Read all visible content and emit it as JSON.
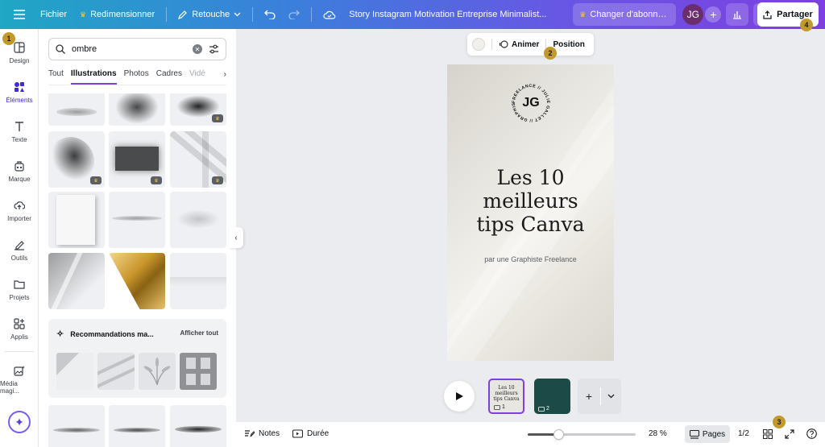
{
  "topbar": {
    "file_label": "Fichier",
    "resize_label": "Redimensionner",
    "edit_label": "Retouche",
    "doc_title": "Story Instagram Motivation Entreprise Minimalist...",
    "upgrade_label": "Changer d'abonne...",
    "avatar_initials": "JG",
    "share_label": "Partager"
  },
  "rail": {
    "items": [
      {
        "label": "Design"
      },
      {
        "label": "Éléments"
      },
      {
        "label": "Texte"
      },
      {
        "label": "Marque"
      },
      {
        "label": "Importer"
      },
      {
        "label": "Outils"
      },
      {
        "label": "Projets"
      },
      {
        "label": "Applis"
      },
      {
        "label": "Média magi..."
      }
    ]
  },
  "panel": {
    "search_value": "ombre",
    "tabs": [
      "Tout",
      "Illustrations",
      "Photos",
      "Cadres",
      "Vidé"
    ],
    "reco_title": "Recommandations ma...",
    "reco_action": "Afficher tout"
  },
  "context_bar": {
    "animate_label": "Animer",
    "position_label": "Position"
  },
  "design": {
    "logo_initials": "JG",
    "logo_ring_text": "FREELANCE // JULIE GALLET // GRAPHISTE",
    "headline_lines": [
      "Les 10",
      "meilleurs",
      "tips Canva"
    ],
    "byline": "par une Graphiste Freelance"
  },
  "thumbnails": {
    "thumb1_lines": [
      "Les 10",
      "meilleurs",
      "tips Canva"
    ],
    "thumb1_num": "1",
    "thumb2_num": "2"
  },
  "bottombar": {
    "notes_label": "Notes",
    "duration_label": "Durée",
    "zoom_value": "28 %",
    "zoom_fraction": 0.28,
    "pages_label": "Pages",
    "page_count": "1/2"
  },
  "badges": [
    "1",
    "2",
    "3",
    "4"
  ],
  "colors": {
    "accent": "#7d3fe0",
    "badge": "#c29a2c",
    "page_thumb_2": "#1c4a46"
  }
}
